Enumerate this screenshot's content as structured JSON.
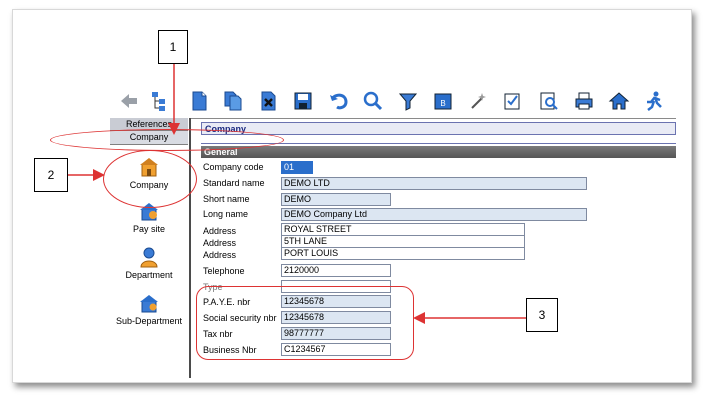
{
  "toolbar": {
    "icons": [
      "back-arrow-icon",
      "tree-icon",
      "new-document-icon",
      "copy-document-icon",
      "delete-document-icon",
      "save-icon",
      "undo-icon",
      "search-icon",
      "filter-icon",
      "report-icon",
      "wand-icon",
      "edit-check-icon",
      "preview-icon",
      "print-icon",
      "home-icon",
      "run-icon"
    ]
  },
  "sidebar": {
    "header": "References",
    "selected": "Company",
    "items": [
      {
        "label": "Company",
        "icon": "company-house-icon"
      },
      {
        "label": "Pay site",
        "icon": "pay-site-icon"
      },
      {
        "label": "Department",
        "icon": "department-person-icon"
      },
      {
        "label": "Sub-Department",
        "icon": "sub-department-icon"
      }
    ]
  },
  "main": {
    "title": "Company",
    "section": "General",
    "fields": {
      "company_code": {
        "label": "Company code",
        "value": "01"
      },
      "standard_name": {
        "label": "Standard name",
        "value": "DEMO LTD"
      },
      "short_name": {
        "label": "Short name",
        "value": "DEMO"
      },
      "long_name": {
        "label": "Long name",
        "value": "DEMO Company Ltd"
      },
      "address1": {
        "label": "Address",
        "value": "ROYAL STREET"
      },
      "address2": {
        "label": "Address",
        "value": "5TH LANE"
      },
      "address3": {
        "label": "Address",
        "value": "PORT LOUIS"
      },
      "telephone": {
        "label": "Telephone",
        "value": "2120000"
      },
      "type": {
        "label": "Type",
        "value": ""
      },
      "paye": {
        "label": "P.A.Y.E. nbr",
        "value": "12345678"
      },
      "social_security": {
        "label": "Social security nbr",
        "value": "12345678"
      },
      "tax": {
        "label": "Tax nbr",
        "value": "98777777"
      },
      "business": {
        "label": "Business Nbr",
        "value": "C1234567"
      }
    }
  },
  "annotations": {
    "a1": "1",
    "a2": "2",
    "a3": "3"
  },
  "colors": {
    "annotation": "#dd3333",
    "field_bg": "#dce6f2",
    "header_text": "#1c2a80",
    "general_bar": "#666666"
  }
}
